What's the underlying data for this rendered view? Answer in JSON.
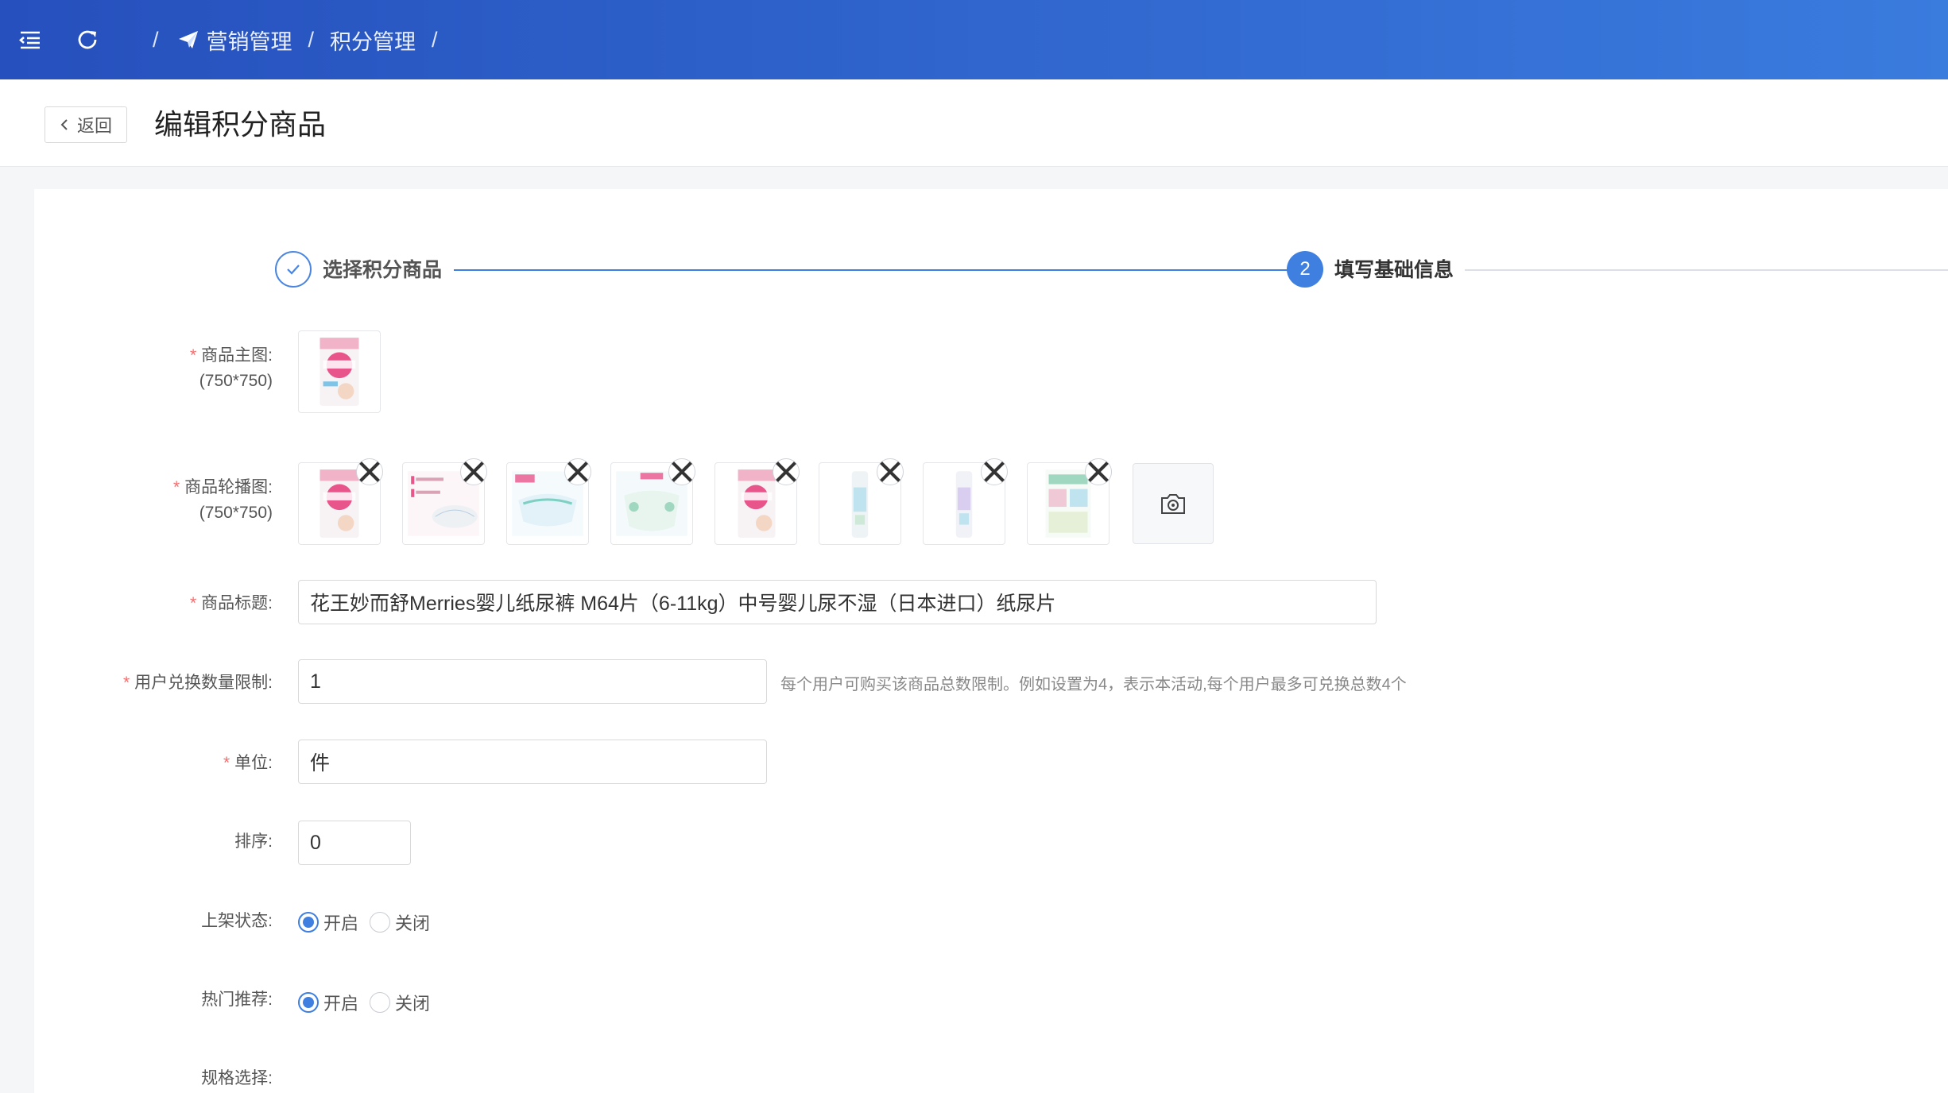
{
  "header": {
    "breadcrumb": [
      "营销管理",
      "积分管理"
    ],
    "sep": "/"
  },
  "subheader": {
    "back_label": "返回",
    "title": "编辑积分商品"
  },
  "steps": [
    {
      "label": "选择积分商品",
      "state": "done"
    },
    {
      "number": "2",
      "label": "填写基础信息",
      "state": "active"
    }
  ],
  "form": {
    "main_image": {
      "label": "商品主图:",
      "size": "(750*750)"
    },
    "carousel": {
      "label": "商品轮播图:",
      "size": "(750*750)",
      "count": 8
    },
    "title": {
      "label": "商品标题:",
      "value": "花王妙而舒Merries婴儿纸尿裤 M64片（6-11kg）中号婴儿尿不湿（日本进口）纸尿片"
    },
    "limit": {
      "label": "用户兑换数量限制:",
      "value": "1",
      "hint": "每个用户可购买该商品总数限制。例如设置为4，表示本活动,每个用户最多可兑换总数4个"
    },
    "unit": {
      "label": "单位:",
      "value": "件"
    },
    "sort": {
      "label": "排序:",
      "value": "0"
    },
    "status": {
      "label": "上架状态:",
      "options": [
        "开启",
        "关闭"
      ],
      "selected": "开启"
    },
    "hot": {
      "label": "热门推荐:",
      "options": [
        "开启",
        "关闭"
      ],
      "selected": "开启"
    },
    "spec": {
      "label": "规格选择:"
    }
  },
  "required_mark": "*",
  "colors": {
    "primary": "#3f7fe0",
    "required": "#f56c6c",
    "header_start": "#2650bd",
    "header_end": "#3a7bde"
  }
}
